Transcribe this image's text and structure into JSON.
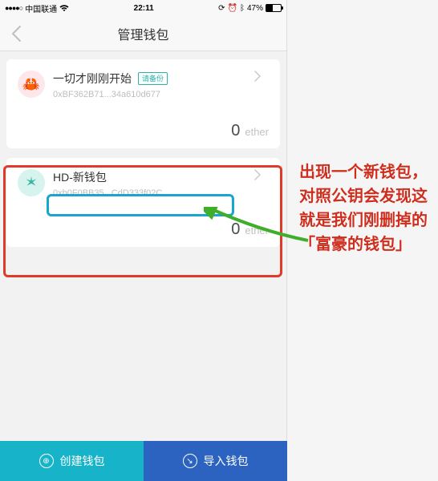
{
  "status": {
    "carrier": "中国联通",
    "signal_dots": "●●●●○",
    "time": "22:11",
    "alarm_icon": "⏰",
    "bluetooth_icon": "ᚼ",
    "battery_percent": "47%"
  },
  "nav": {
    "title": "管理钱包"
  },
  "wallets": [
    {
      "name": "一切才刚刚开始",
      "backup_tag": "请备份",
      "address": "0xBF362B71...34a610d677",
      "balance": "0",
      "unit": "ether",
      "icon": "🦀"
    },
    {
      "name": "HD-新钱包",
      "address": "0xb0F0BB35...CdD333f02C",
      "balance": "0",
      "unit": "ether",
      "icon": "✳"
    }
  ],
  "bottom": {
    "create": "创建钱包",
    "import": "导入钱包"
  },
  "annotation": {
    "text": "出现一个新钱包，对照公钥会发现这就是我们刚删掉的「富豪的钱包」"
  }
}
